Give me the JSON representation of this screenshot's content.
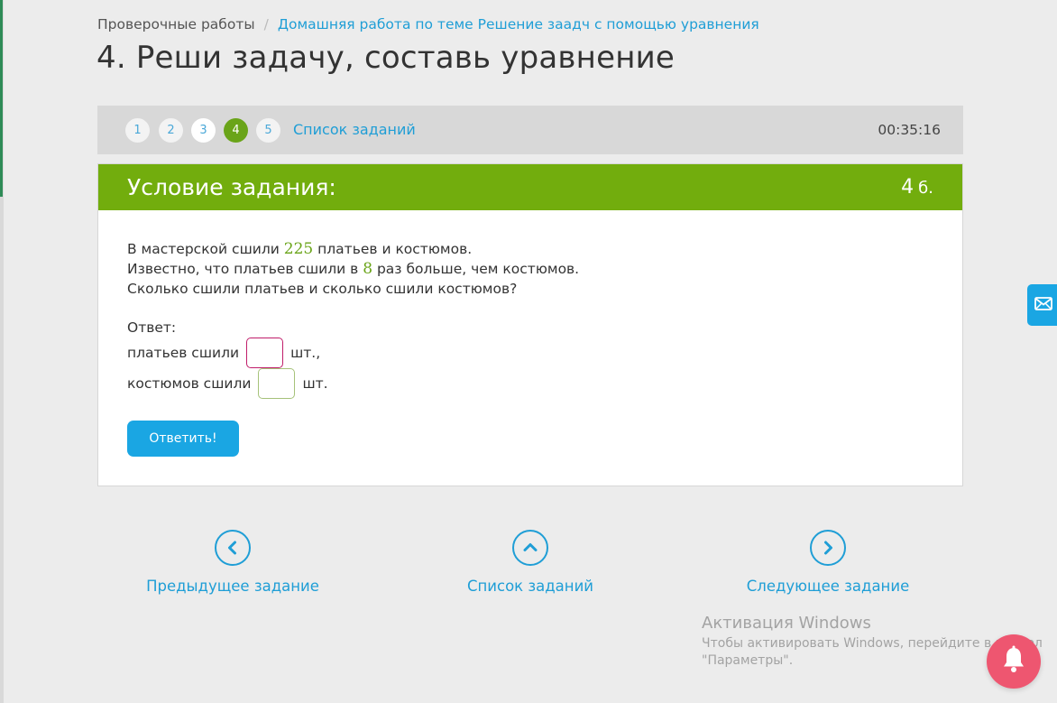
{
  "breadcrumb": {
    "root": "Проверочные работы",
    "separator": "/",
    "current": "Домашняя работа по теме Решение заадч с помощью уравнения"
  },
  "page_title": "4. Реши задачу, составь уравнение",
  "task_nav": {
    "numbers": [
      "1",
      "2",
      "3",
      "4",
      "5"
    ],
    "active": "4",
    "list_label": "Список заданий",
    "timer": "00:35:16"
  },
  "task": {
    "header_title": "Условие задания:",
    "points_value": "4",
    "points_unit": "б.",
    "line1_pre": "В мастерской сшили",
    "line1_num": "225",
    "line1_post": "платьев и костюмов.",
    "line2_pre": "Известно, что платьев сшили в",
    "line2_num": "8",
    "line2_post": "раз больше, чем костюмов.",
    "line3": "Сколько сшили платьев и сколько сшили костюмов?"
  },
  "answer": {
    "label": "Ответ:",
    "row1_label": "платьев сшили",
    "row1_unit": "шт.,",
    "row1_value": "",
    "row2_label": "костюмов сшили",
    "row2_unit": "шт.",
    "row2_value": "",
    "submit_label": "Ответить!"
  },
  "footer_nav": {
    "prev_label": "Предыдущее задание",
    "list_label": "Список заданий",
    "next_label": "Следующее задание"
  },
  "windows_notice": {
    "title": "Активация Windows",
    "line1": "Чтобы активировать Windows, перейдите в раздел",
    "line2": "\"Параметры\"."
  },
  "colors": {
    "accent_green": "#72ad0d",
    "link_blue": "#1f9ed6",
    "button_blue": "#1aa6e3",
    "bell_pink": "#ee5670"
  },
  "icons": {
    "prev": "chevron-left-icon",
    "list": "chevron-up-icon",
    "next": "chevron-right-icon",
    "mail": "envelope-icon",
    "bell": "bell-icon"
  }
}
